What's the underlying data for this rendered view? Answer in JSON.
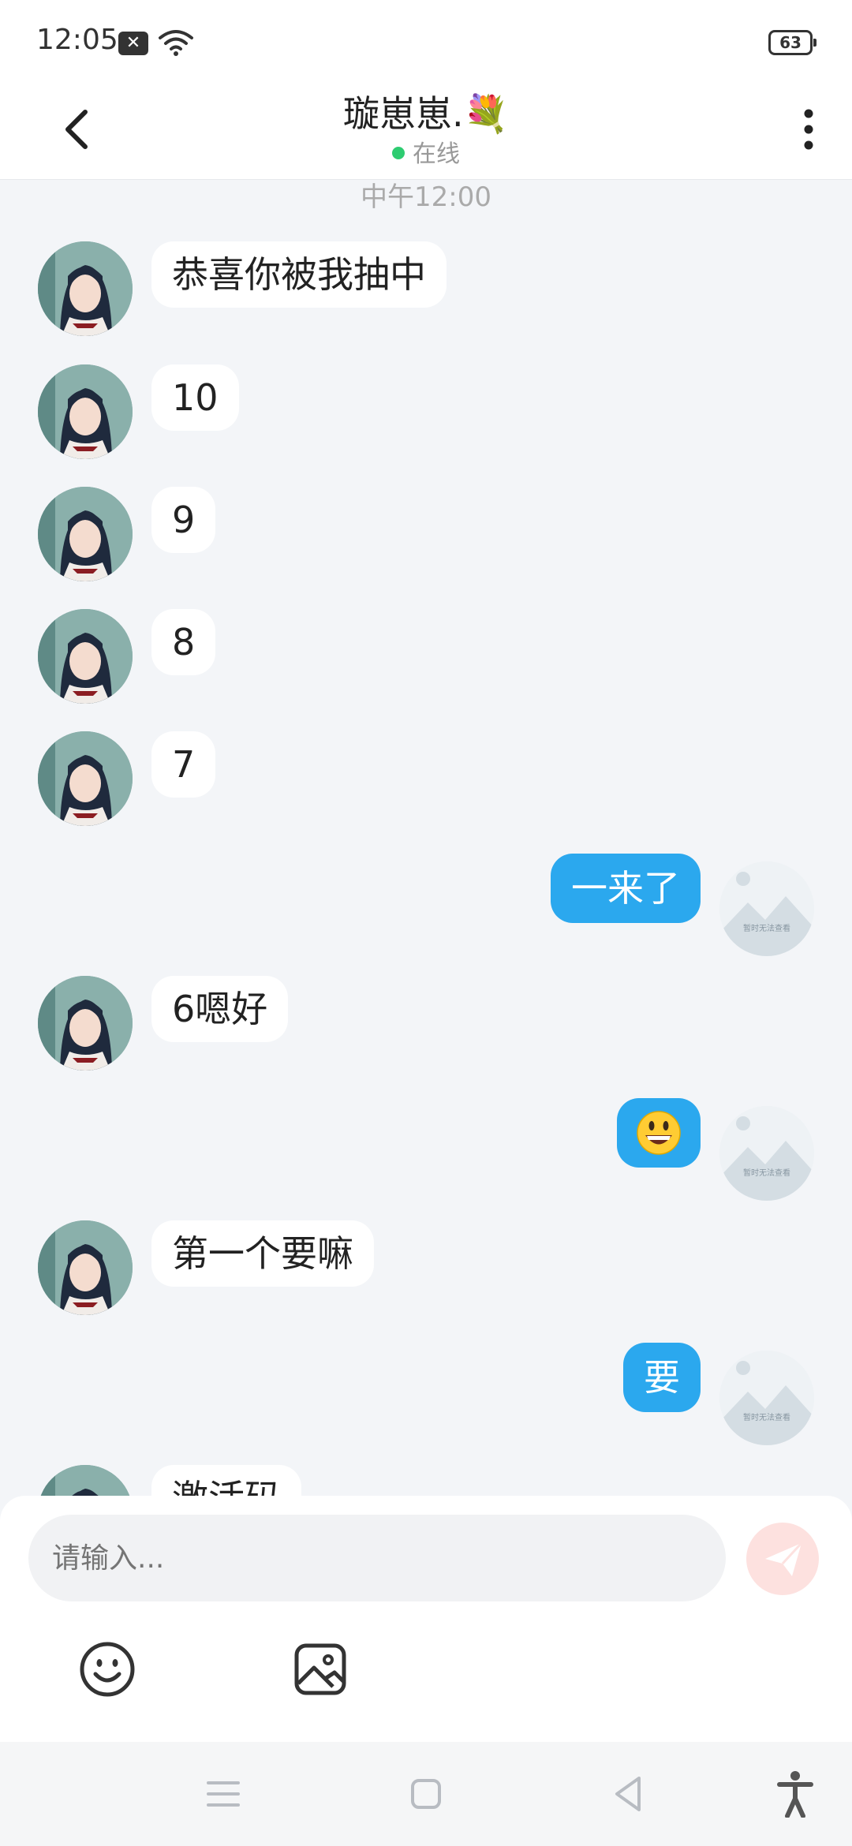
{
  "status_bar": {
    "time": "12:05",
    "battery": "63"
  },
  "header": {
    "name": "璇崽崽.💐",
    "status": "在线"
  },
  "chat": {
    "time_separator": "中午12:00",
    "messages": [
      {
        "from": "them",
        "text": "恭喜你被我抽中"
      },
      {
        "from": "them",
        "text": "10"
      },
      {
        "from": "them",
        "text": "9"
      },
      {
        "from": "them",
        "text": "8"
      },
      {
        "from": "them",
        "text": "7"
      },
      {
        "from": "me",
        "text": "一来了"
      },
      {
        "from": "them",
        "text": "6嗯好"
      },
      {
        "from": "me",
        "text": "😃"
      },
      {
        "from": "them",
        "text": "第一个要嘛"
      },
      {
        "from": "me",
        "text": "要"
      },
      {
        "from": "them",
        "text": "激活码"
      }
    ],
    "self_avatar_caption": "暂时无法查看"
  },
  "input": {
    "placeholder": "请输入..."
  },
  "colors": {
    "outgoing_bubble": "#2ba8ee",
    "incoming_bubble": "#ffffff",
    "online": "#2ecc71",
    "send_button": "#fde1df"
  }
}
